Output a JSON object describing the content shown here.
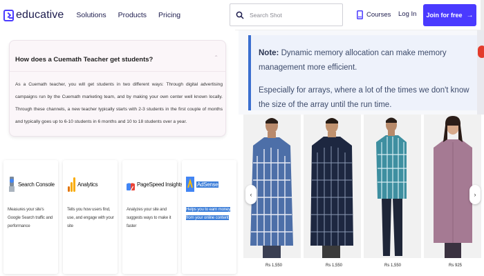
{
  "nav": {
    "logo": "educative",
    "items": [
      "Solutions",
      "Products",
      "Pricing"
    ]
  },
  "faq": {
    "question": "How does a Cuemath Teacher get students?",
    "answer": "As a Cuemath teacher, you will get students in two different ways: Through digital advertising campaigns run by the Cuemath marketing team, and by making your own center well known locally. Through these channels, a new teacher typically starts with 2-3 students in the first couple of months and typically goes up to 6-10 students in 6 months and 10 to 18 students over a year."
  },
  "tools": [
    {
      "title": "Search Console",
      "desc": "Measures your site's Google Search traffic and performance"
    },
    {
      "title": "Analytics",
      "desc": "Tells you how users find, use, and engage with your site"
    },
    {
      "title": "PageSpeed Insights",
      "desc": "Analyzes your site and suggests ways to make it faster"
    },
    {
      "title": "AdSense",
      "desc": "Helps you to earn money from your online content"
    }
  ],
  "header": {
    "search_placeholder": "Search Shot",
    "courses": "Courses",
    "login": "Log In",
    "join": "Join for free"
  },
  "note": {
    "label": "Note:",
    "text1": "Dynamic memory allocation can make memory management more efficient.",
    "text2": "Especially for arrays, where a lot of the times we don't know the size of the array until the run time."
  },
  "products": [
    {
      "price": "Rs 1,550",
      "shirt_color": "#4d6fa8"
    },
    {
      "price": "Rs 1,550",
      "shirt_color": "#1d2740"
    },
    {
      "price": "Rs 1,550",
      "shirt_color": "#3e8fa0"
    },
    {
      "price": "Rs 925",
      "shirt_color": "#a57a93"
    }
  ],
  "colors": {
    "brand": "#4a3aff",
    "note_accent": "#3b6fd0",
    "highlight": "#3b7dd8"
  }
}
